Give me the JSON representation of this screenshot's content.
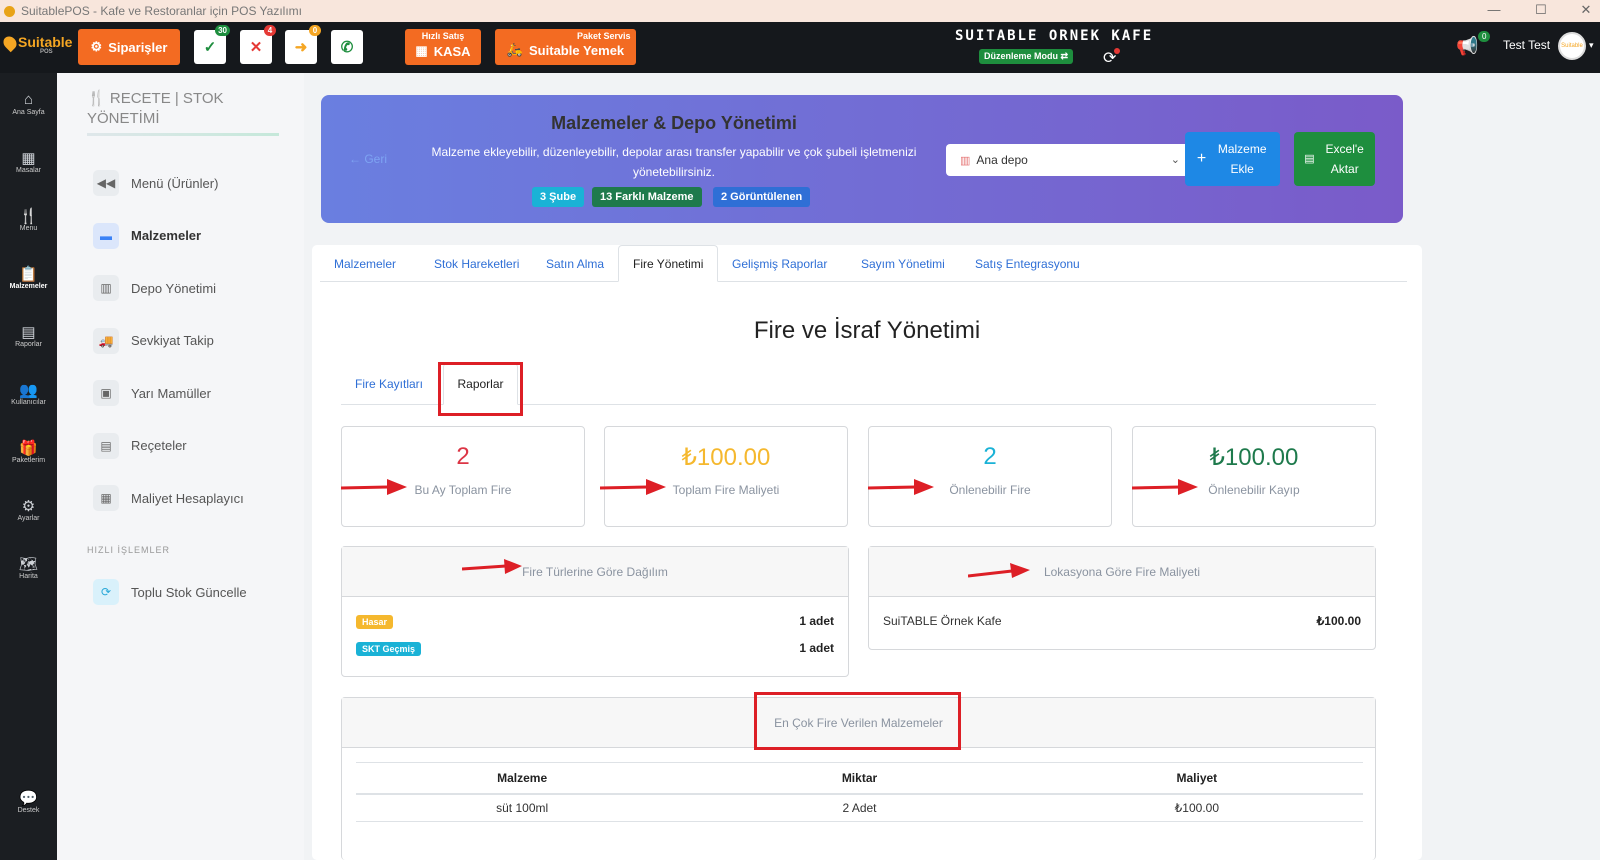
{
  "window": {
    "title": "SuitablePOS - Kafe ve Restoranlar için POS Yazılımı",
    "minimize": "—",
    "maximize": "☐",
    "close": "✕"
  },
  "topbar": {
    "logo_text": "Suitable",
    "logo_sub": "POS",
    "orders_label": "Siparişler",
    "status_buttons": [
      {
        "icon": "✓",
        "badge": "30",
        "color": "#1e8e3e"
      },
      {
        "icon": "✕",
        "badge": "4",
        "color": "#e53935"
      },
      {
        "icon": "➜",
        "badge": "0",
        "color": "#f5a623"
      },
      {
        "icon": "✆",
        "badge": "",
        "color": "#1e8e3e"
      }
    ],
    "quick_sale_sup": "Hızlı Satış",
    "quick_sale_label": "KASA",
    "package_sup": "Paket Servis",
    "package_label": "Suitable Yemek",
    "cafe_name": "SUITABLE ORNEK KAFE",
    "edit_mode": "Düzenleme Modu ⇄",
    "notif_badge": "0",
    "user_name": "Test Test",
    "avatar_text": "Suitable"
  },
  "leftnav": [
    {
      "label": "Ana Sayfa",
      "icon": "home-icon",
      "glyph": "⌂"
    },
    {
      "label": "Masalar",
      "icon": "tables-icon",
      "glyph": "▦"
    },
    {
      "label": "Menu",
      "icon": "utensils-icon",
      "glyph": "🍴"
    },
    {
      "label": "Malzemeler",
      "icon": "clipboard-icon",
      "glyph": "📋",
      "active": true
    },
    {
      "label": "Raporlar",
      "icon": "report-icon",
      "glyph": "▤"
    },
    {
      "label": "Kullanıcılar",
      "icon": "users-icon",
      "glyph": "👥"
    },
    {
      "label": "Paketlerim",
      "icon": "gift-icon",
      "glyph": "🎁"
    },
    {
      "label": "Ayarlar",
      "icon": "gears-icon",
      "glyph": "⚙"
    },
    {
      "label": "Harita",
      "icon": "map-icon",
      "glyph": "🗺"
    },
    {
      "label": "Destek",
      "icon": "chat-icon",
      "glyph": "💬"
    }
  ],
  "sidepanel": {
    "title": "RECETE | STOK YÖNETİMİ",
    "items": [
      {
        "label": "Menü (Ürünler)",
        "glyph": "◀◀"
      },
      {
        "label": "Malzemeler",
        "glyph": "▬",
        "active": true
      },
      {
        "label": "Depo Yönetimi",
        "glyph": "▥"
      },
      {
        "label": "Sevkiyat Takip",
        "glyph": "🚚"
      },
      {
        "label": "Yarı Mamüller",
        "glyph": "▣"
      },
      {
        "label": "Reçeteler",
        "glyph": "▤"
      },
      {
        "label": "Maliyet Hesaplayıcı",
        "glyph": "▦"
      }
    ],
    "quick_section": "HIZLI İŞLEMLER",
    "quick_item": "Toplu Stok Güncelle"
  },
  "banner": {
    "back": "← Geri",
    "title": "Malzemeler & Depo Yönetimi",
    "description": "Malzeme ekleyebilir, düzenleyebilir, depolar arası transfer yapabilir ve çok şubeli işletmenizi yönetebilirsiniz.",
    "chips": [
      {
        "label": "3 Şube",
        "color": "#1ab2d6"
      },
      {
        "label": "13 Farklı Malzeme",
        "color": "#1e7a4c"
      },
      {
        "label": "2 Görüntülenen",
        "color": "#2f6fd6"
      }
    ],
    "warehouse_select": "Ana depo",
    "add_button": "Malzeme Ekle",
    "export_button": "Excel'e Aktar"
  },
  "tabs": [
    "Malzemeler",
    "Stok Hareketleri",
    "Satın Alma",
    "Fire Yönetimi",
    "Gelişmiş Raporlar",
    "Sayım Yönetimi",
    "Satış Entegrasyonu"
  ],
  "active_tab": "Fire Yönetimi",
  "section_title": "Fire ve İsraf Yönetimi",
  "subtabs": [
    "Fire Kayıtları",
    "Raporlar"
  ],
  "stats": [
    {
      "value": "2",
      "label": "Bu Ay Toplam Fire",
      "color": "#dc3545"
    },
    {
      "value": "₺100.00",
      "label": "Toplam Fire Maliyeti",
      "color": "#f5b82e"
    },
    {
      "value": "2",
      "label": "Önlenebilir Fire",
      "color": "#1ab2d6"
    },
    {
      "value": "₺100.00",
      "label": "Önlenebilir Kayıp",
      "color": "#1e7a4c"
    }
  ],
  "fire_types": {
    "title": "Fire Türlerine Göre Dağılım",
    "rows": [
      {
        "type": "Hasar",
        "count": "1 adet",
        "color": "#f5b82e"
      },
      {
        "type": "SKT Geçmiş",
        "count": "1 adet",
        "color": "#1ab2d6"
      }
    ]
  },
  "location_cost": {
    "title": "Lokasyona Göre Fire Maliyeti",
    "rows": [
      {
        "location": "SuiTABLE Örnek Kafe",
        "cost": "₺100.00"
      }
    ]
  },
  "top_materials": {
    "title": "En Çok Fire Verilen Malzemeler",
    "headers": [
      "Malzeme",
      "Miktar",
      "Maliyet"
    ],
    "rows": [
      [
        "süt 100ml",
        "2 Adet",
        "₺100.00"
      ]
    ]
  },
  "colors": {
    "accent": "#f36b22",
    "annotation_red": "#dd1f26",
    "primary": "#2f6fd6"
  }
}
